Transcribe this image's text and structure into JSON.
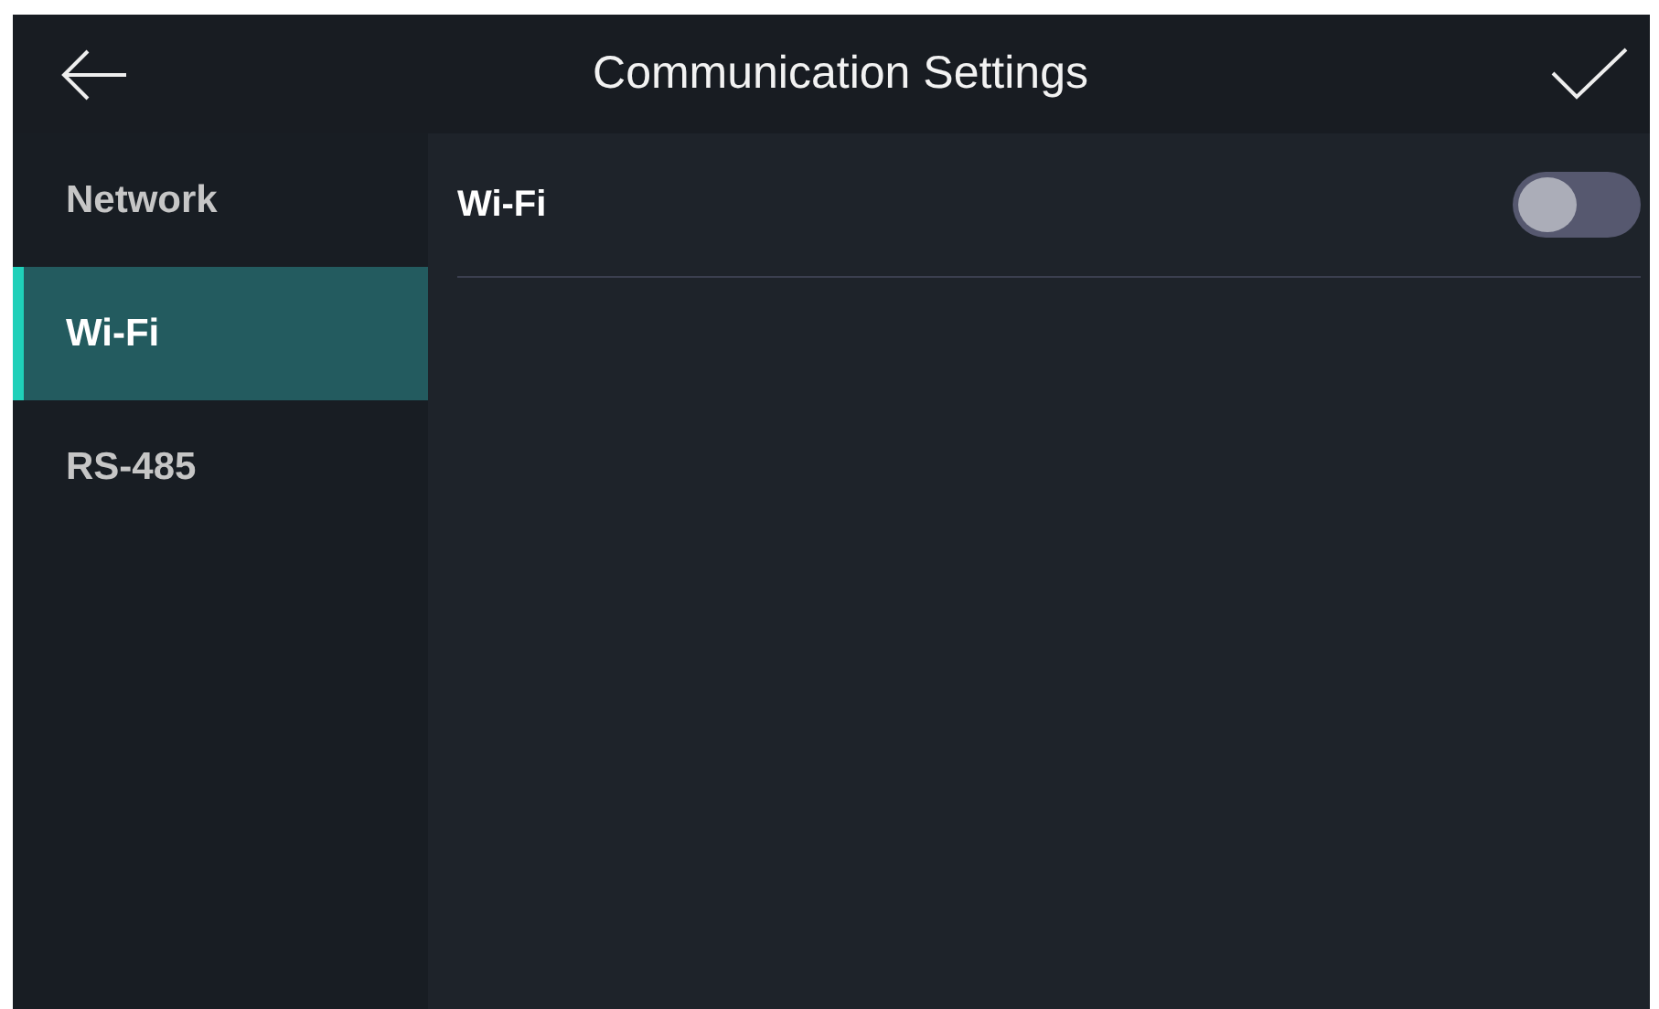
{
  "header": {
    "title": "Communication Settings"
  },
  "sidebar": {
    "items": [
      {
        "label": "Network",
        "selected": false
      },
      {
        "label": "Wi-Fi",
        "selected": true
      },
      {
        "label": "RS-485",
        "selected": false
      }
    ]
  },
  "settings": [
    {
      "label": "Wi-Fi",
      "kind": "toggle",
      "on": false
    }
  ]
}
